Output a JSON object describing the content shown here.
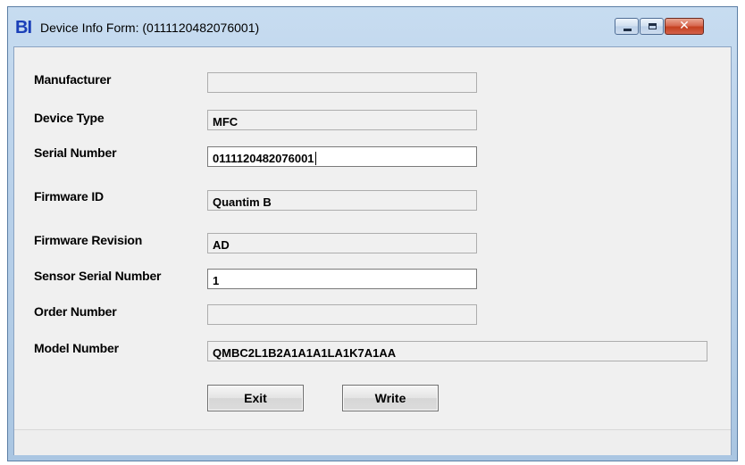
{
  "window": {
    "icon_text": "BI",
    "title": "Device Info Form: (0111120482076001)",
    "controls": {
      "minimize": "minimize",
      "maximize": "maximize",
      "close_glyph": "✕"
    }
  },
  "form": {
    "manufacturer": {
      "label": "Manufacturer",
      "value": ""
    },
    "device_type": {
      "label": "Device Type",
      "value": "MFC"
    },
    "serial_number": {
      "label": "Serial Number",
      "value": "0111120482076001"
    },
    "firmware_id": {
      "label": "Firmware ID",
      "value": "Quantim B"
    },
    "firmware_revision": {
      "label": "Firmware Revision",
      "value": "AD"
    },
    "sensor_serial_number": {
      "label": "Sensor Serial Number",
      "value": "1"
    },
    "order_number": {
      "label": "Order Number",
      "value": ""
    },
    "model_number": {
      "label": "Model Number",
      "value": "QMBC2L1B2A1A1A1LA1K7A1AA"
    }
  },
  "buttons": {
    "exit": "Exit",
    "write": "Write"
  },
  "colors": {
    "title_bar": "#b9d1ea",
    "client_bg": "#f0f0f0",
    "close_button": "#c4401f",
    "icon_blue": "#1a3fb8",
    "icon_red": "#d01818"
  }
}
